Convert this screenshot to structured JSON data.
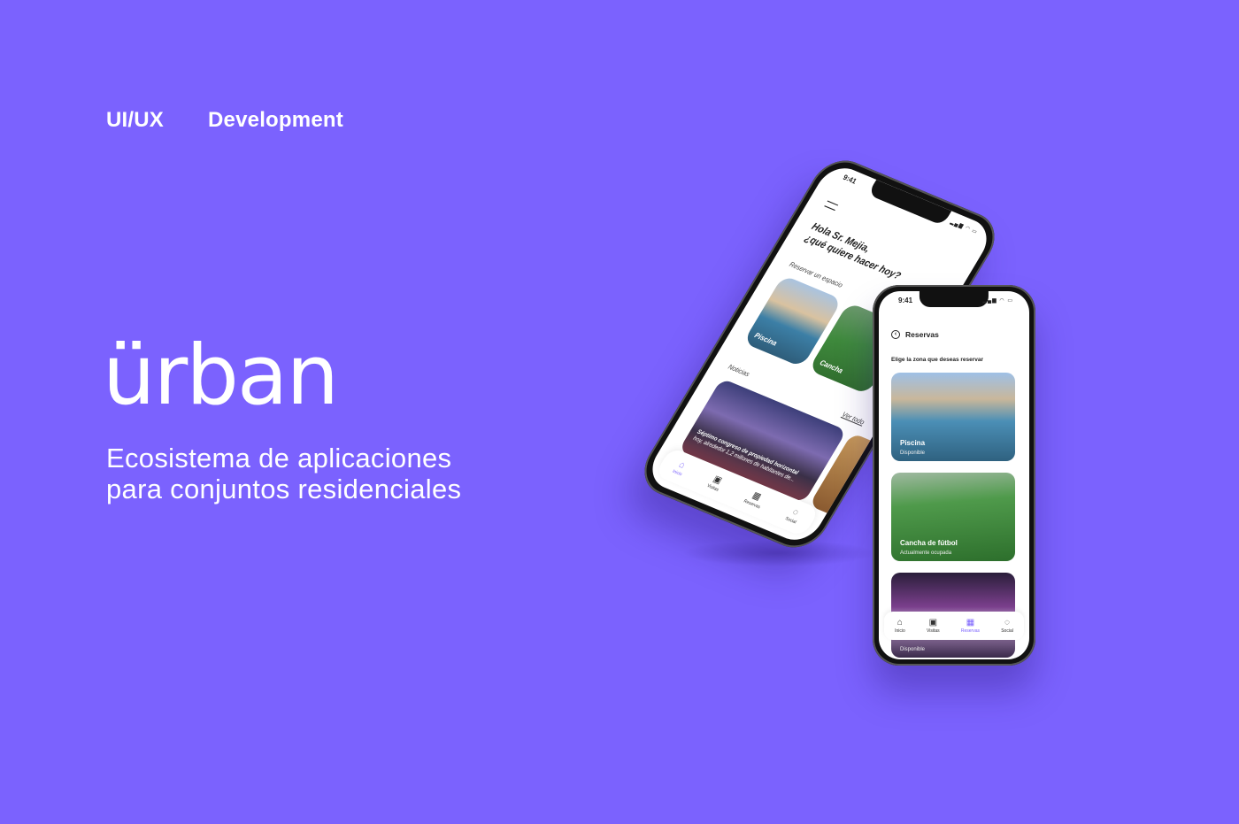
{
  "tags": {
    "left": "UI/UX",
    "right": "Development"
  },
  "brand": {
    "logo": "ürban"
  },
  "tagline": {
    "line1": "Ecosistema de aplicaciones",
    "line2": "para conjuntos residenciales"
  },
  "phone_home": {
    "time": "9:41",
    "greeting_line1": "Hola Sr. Mejia,",
    "greeting_line2": "¿qué quiere hacer hoy?",
    "reserve_label": "Reservar un espacio",
    "spaces": [
      "Piscina",
      "Cancha"
    ],
    "news_label": "Noticias",
    "see_all": "Ver todo",
    "news_title": "Séptimo congreso de propiedad horizontal",
    "news_sub": "hoy, alrededor 1,2 millones de habitantes de...",
    "tabs": [
      "Inicio",
      "Visitas",
      "Reservas",
      "Social"
    ]
  },
  "phone_reservas": {
    "time": "9:41",
    "title": "Reservas",
    "subtitle": "Elige la zona que deseas reservar",
    "zones": [
      {
        "name": "Piscina",
        "status": "Disponible"
      },
      {
        "name": "Cancha de fútbol",
        "status": "Actualmente ocupada"
      },
      {
        "name": "",
        "status": "Disponible"
      }
    ],
    "tabs": [
      "Inicio",
      "Visitas",
      "Reservas",
      "Social"
    ]
  },
  "colors": {
    "background": "#7b62fe",
    "accent": "#7b62fe"
  }
}
